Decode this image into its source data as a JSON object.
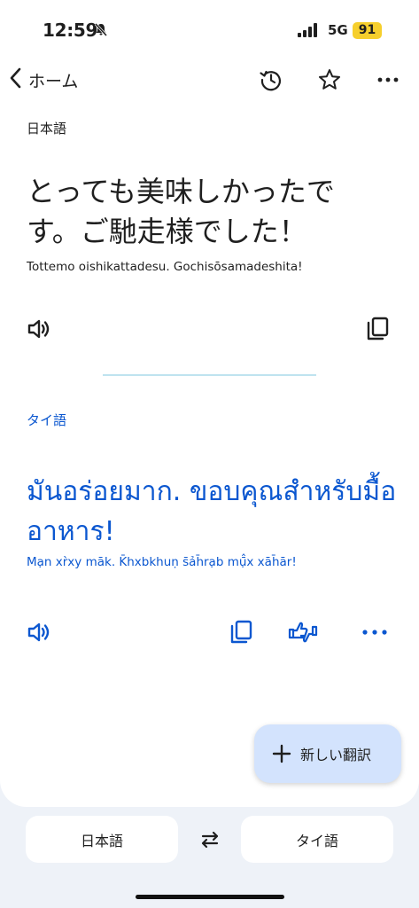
{
  "status_bar": {
    "time": "12:59",
    "network": "5G",
    "battery": "91"
  },
  "nav": {
    "back_label": "ホーム",
    "icons": [
      "history-icon",
      "star-icon",
      "more-vert-icon"
    ]
  },
  "source": {
    "language": "日本語",
    "text": "とっても美味しかったです。ご馳走様でした！",
    "romanization": "Tottemo oishikattadesu. Gochisōsamadeshita!"
  },
  "target": {
    "language": "タイ語",
    "text": "มันอร่อยมาก. ขอบคุณสำหรับมื้ออาหาร!",
    "romanization": "Mạn xr̀xy māk. K̄hxbkhuṇ s̄ảh̄rạb mụ̄̂x xāh̄ār!"
  },
  "fab": {
    "label": "新しい翻訳"
  },
  "language_bar": {
    "source": "日本語",
    "target": "タイ語"
  },
  "colors": {
    "accent": "#0b57d0",
    "fab_bg": "#d3e3fd",
    "divider": "#bfe3ef",
    "battery": "#f6cf2d",
    "page_bg": "#eef2f8"
  }
}
